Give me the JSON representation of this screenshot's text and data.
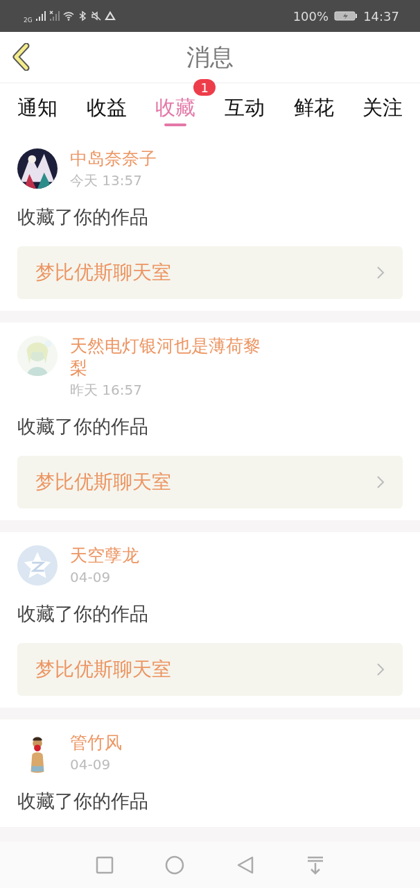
{
  "status_bar": {
    "network": "2G",
    "battery": "100%",
    "time": "14:37"
  },
  "header": {
    "title": "消息"
  },
  "tabs": [
    {
      "label": "通知",
      "selected": false
    },
    {
      "label": "收益",
      "selected": false
    },
    {
      "label": "收藏",
      "selected": true,
      "badge": "1"
    },
    {
      "label": "互动",
      "selected": false
    },
    {
      "label": "鲜花",
      "selected": false
    },
    {
      "label": "关注",
      "selected": false
    }
  ],
  "messages": [
    {
      "name": "中岛奈奈子",
      "time": "今天 13:57",
      "text": "收藏了你的作品",
      "work": "梦比优斯聊天室"
    },
    {
      "name": "天然电灯银河也是薄荷黎梨",
      "time": "昨天 16:57",
      "text": "收藏了你的作品",
      "work": "梦比优斯聊天室"
    },
    {
      "avatar": {
        "kind": "icon"
      },
      "name": "天空孽龙",
      "time": "04-09",
      "text": "收藏了你的作品",
      "work": "梦比优斯聊天室"
    },
    {
      "name": "管竹风",
      "time": "04-09",
      "text": "收藏了你的作品"
    }
  ]
}
